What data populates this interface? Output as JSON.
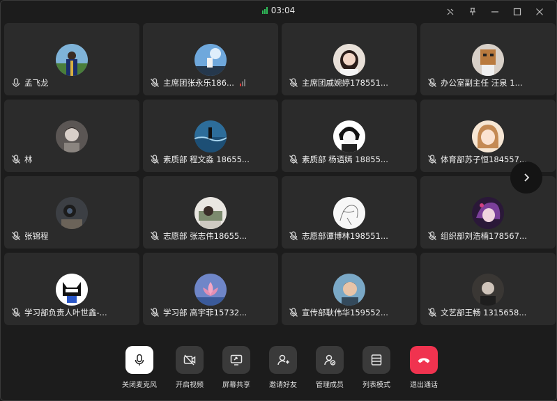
{
  "call": {
    "timer": "03:04"
  },
  "window_controls": [
    "unpin-icon",
    "pin-icon",
    "minimize-icon",
    "maximize-icon",
    "close-icon"
  ],
  "participants": [
    {
      "name": "孟飞龙",
      "muted": false,
      "avatar": "graduation-photo"
    },
    {
      "name": "主席团张永乐186...",
      "muted": true,
      "avatar": "sky-photo",
      "volume_indicator": true
    },
    {
      "name": "主席团戚婉婷178551...",
      "muted": true,
      "avatar": "girl-photo"
    },
    {
      "name": "办公室副主任 汪泉 1...",
      "muted": true,
      "avatar": "box-character"
    },
    {
      "name": "林",
      "muted": true,
      "avatar": "portrait-photo"
    },
    {
      "name": "素质部 程文淼 18655...",
      "muted": true,
      "avatar": "sea-photo"
    },
    {
      "name": "素质部 杨语嫣 18855...",
      "muted": true,
      "avatar": "anime-boy"
    },
    {
      "name": "体育部苏子恒184557...",
      "muted": true,
      "avatar": "anime-girl"
    },
    {
      "name": "张锦程",
      "muted": true,
      "avatar": "camera-photo"
    },
    {
      "name": "志愿部 张志伟18655...",
      "muted": true,
      "avatar": "sleeping-photo"
    },
    {
      "name": "志愿部谭博林198551...",
      "muted": true,
      "avatar": "sketch-drawing"
    },
    {
      "name": "组织部刘浩楠178567...",
      "muted": true,
      "avatar": "purple-anime"
    },
    {
      "name": "学习部负责人叶世鑫-...",
      "muted": true,
      "avatar": "cat-cartoon"
    },
    {
      "name": "学习部 高宇菲15732...",
      "muted": true,
      "avatar": "lotus-photo"
    },
    {
      "name": "宣传部耿伟华159552...",
      "muted": true,
      "avatar": "boy-photo"
    },
    {
      "name": "文艺部王畅 1315658...",
      "muted": true,
      "avatar": "dark-portrait"
    }
  ],
  "toolbar": {
    "mute": "关闭麦克风",
    "video": "开启视频",
    "share": "屏幕共享",
    "invite": "邀请好友",
    "manage": "管理成员",
    "layout": "列表模式",
    "leave": "退出通话"
  },
  "colors": {
    "accent_green": "#2fbf5a",
    "leave_red": "#f0334f",
    "tile_bg": "#2b2b2b",
    "window_bg": "#1c1c1c"
  }
}
